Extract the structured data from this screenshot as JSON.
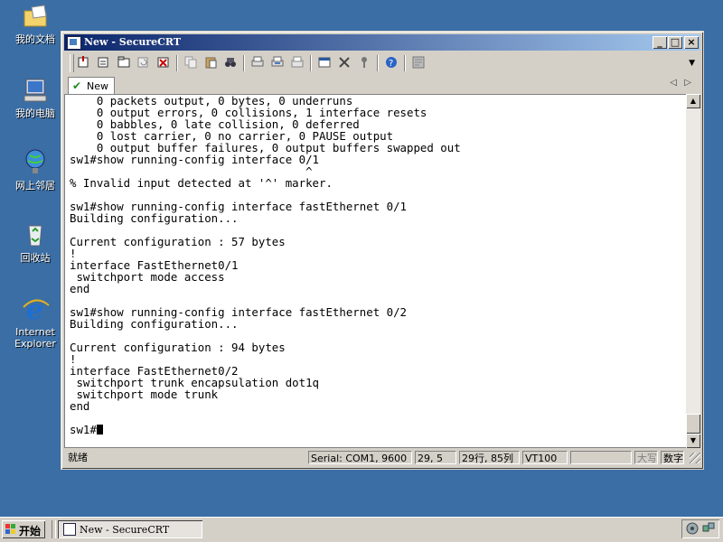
{
  "desktop": {
    "icons": [
      {
        "label": "我的文档",
        "icon": "folder-icon"
      },
      {
        "label": "我的电脑",
        "icon": "computer-icon"
      },
      {
        "label": "网上邻居",
        "icon": "network-icon"
      },
      {
        "label": "回收站",
        "icon": "recycle-bin-icon"
      },
      {
        "label1": "Internet",
        "label2": "Explorer",
        "icon": "ie-icon"
      }
    ]
  },
  "window": {
    "title": "New - SecureCRT",
    "title_buttons": {
      "minimize": "_",
      "maximize": "□",
      "close": "×"
    },
    "tab": {
      "label": "New"
    },
    "terminal_lines": [
      "    0 packets output, 0 bytes, 0 underruns",
      "    0 output errors, 0 collisions, 1 interface resets",
      "    0 babbles, 0 late collision, 0 deferred",
      "    0 lost carrier, 0 no carrier, 0 PAUSE output",
      "    0 output buffer failures, 0 output buffers swapped out",
      "sw1#show running-config interface 0/1",
      "                                   ^",
      "% Invalid input detected at '^' marker.",
      "",
      "sw1#show running-config interface fastEthernet 0/1",
      "Building configuration...",
      "",
      "Current configuration : 57 bytes",
      "!",
      "interface FastEthernet0/1",
      " switchport mode access",
      "end",
      "",
      "sw1#show running-config interface fastEthernet 0/2",
      "Building configuration...",
      "",
      "Current configuration : 94 bytes",
      "!",
      "interface FastEthernet0/2",
      " switchport trunk encapsulation dot1q",
      " switchport mode trunk",
      "end",
      ""
    ],
    "prompt": "sw1#",
    "status": {
      "ready": "就绪",
      "connection": "Serial: COM1, 9600",
      "cursor_pos": "29,  5",
      "size": "29行, 85列",
      "emulation": "VT100",
      "blank": "",
      "caps": "大写",
      "num": "数字"
    }
  },
  "taskbar": {
    "start_label": "开始",
    "task_label": "New - SecureCRT"
  },
  "colors": {
    "desktop": "#3a6ea5",
    "title_active": "#0a246a"
  }
}
